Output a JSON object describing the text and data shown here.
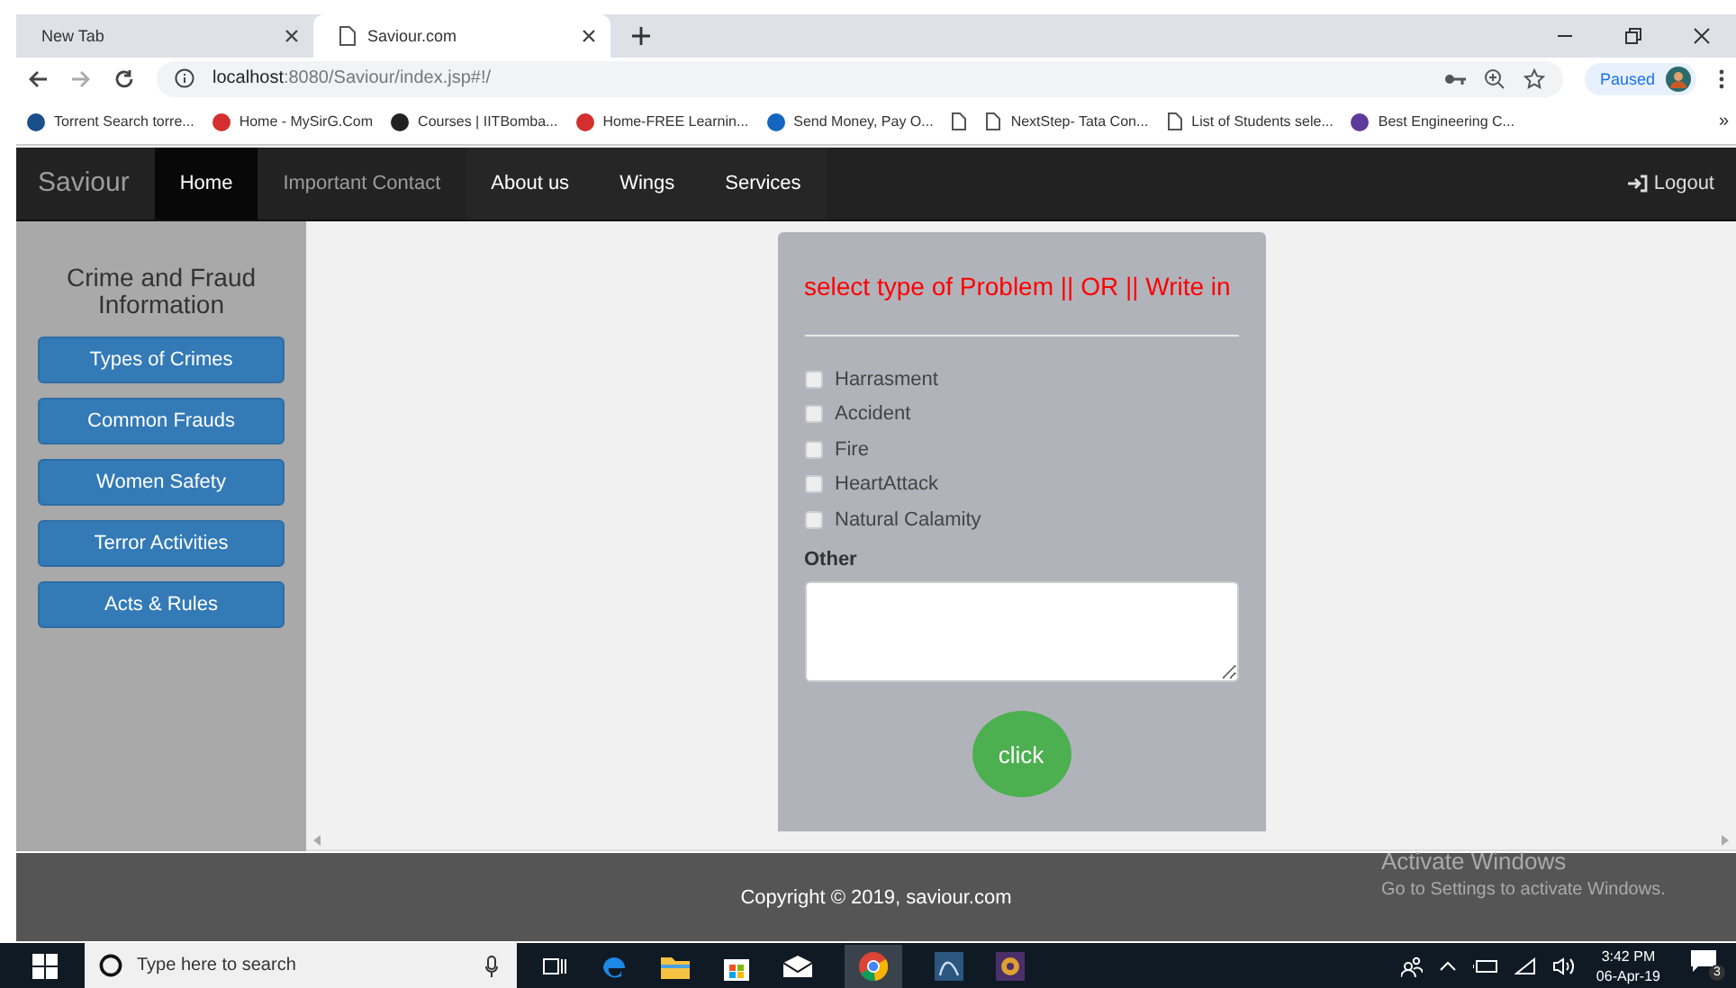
{
  "browser": {
    "tabs": [
      {
        "title": "New Tab",
        "selected": false
      },
      {
        "title": "Saviour.com",
        "selected": true
      }
    ],
    "url_host": "localhost",
    "url_path": ":8080/Saviour/index.jsp#!/",
    "profile": "Paused",
    "bookmarks": [
      {
        "kind": "link",
        "label": "Torrent Search torre..."
      },
      {
        "kind": "link",
        "label": "Home - MySirG.Com"
      },
      {
        "kind": "link",
        "label": "Courses | IITBomba..."
      },
      {
        "kind": "link",
        "label": "Home-FREE Learnin..."
      },
      {
        "kind": "link",
        "label": "Send Money, Pay O..."
      },
      {
        "kind": "icon"
      },
      {
        "kind": "link",
        "label": "NextStep- Tata Con..."
      },
      {
        "kind": "link",
        "label": "List of Students sele..."
      },
      {
        "kind": "link",
        "label": "Best Engineering C..."
      }
    ],
    "more": "»"
  },
  "navbar": {
    "brand": "Saviour",
    "items": [
      {
        "label": "Home",
        "selected": true,
        "disabled": false
      },
      {
        "label": "Important Contact",
        "selected": false,
        "disabled": true
      },
      {
        "label": "About us",
        "selected": false,
        "disabled": false
      },
      {
        "label": "Wings",
        "selected": false,
        "disabled": false
      },
      {
        "label": "Services",
        "selected": false,
        "disabled": false
      }
    ],
    "logout": "Logout"
  },
  "sidebar": {
    "title": "Crime and Fraud Information",
    "buttons": [
      "Types of Crimes",
      "Common Frauds",
      "Women Safety",
      "Terror Activities",
      "Acts & Rules"
    ]
  },
  "form": {
    "heading": "select type of Problem || OR || Write in",
    "options": [
      {
        "label": "Harrasment",
        "checked": false
      },
      {
        "label": "Accident",
        "checked": false
      },
      {
        "label": "Fire",
        "checked": false
      },
      {
        "label": "HeartAttack",
        "checked": false
      },
      {
        "label": "Natural Calamity",
        "checked": false
      }
    ],
    "other_label": "Other",
    "submit": "click"
  },
  "footer": {
    "copyright": "Copyright © 2019, saviour.com"
  },
  "activation": {
    "title": "Activate Windows",
    "subtitle": "Go to Settings to activate Windows."
  },
  "taskbar": {
    "search_placeholder": "Type here to search",
    "time": "3:42 PM",
    "date": "06-Apr-19",
    "notifications": "3"
  }
}
